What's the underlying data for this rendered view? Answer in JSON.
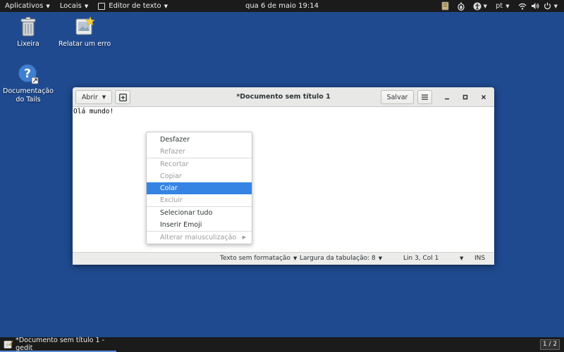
{
  "topbar": {
    "applications": "Aplicativos",
    "places": "Locais",
    "text_editor": "Editor de texto",
    "clock": "qua 6 de maio  19:14",
    "language": "pt",
    "tray_icons": [
      "keyring-icon",
      "tor-onion-icon",
      "accessibility-icon",
      "network-wifi-icon",
      "volume-icon",
      "power-icon"
    ]
  },
  "desktop": {
    "icons": [
      {
        "label": "Lixeira",
        "icon": "trash-icon"
      },
      {
        "label": "Relatar um erro",
        "icon": "report-bug-icon"
      },
      {
        "label": "Documentação do Tails",
        "icon": "help-documentation-icon"
      }
    ]
  },
  "window": {
    "title": "*Documento sem título 1",
    "open_label": "Abrir",
    "save_label": "Salvar",
    "content": "Olá mundo!",
    "statusbar": {
      "format": "Texto sem formatação",
      "tab_width": "Largura da tabulação: 8",
      "position": "Lin 3, Col 1",
      "mode": "INS"
    }
  },
  "context_menu": {
    "items": [
      {
        "label": "Desfazer",
        "enabled": true
      },
      {
        "label": "Refazer",
        "enabled": false
      },
      {
        "label": "Recortar",
        "enabled": false
      },
      {
        "label": "Copiar",
        "enabled": false
      },
      {
        "label": "Colar",
        "enabled": true,
        "selected": true
      },
      {
        "label": "Excluir",
        "enabled": false
      },
      {
        "label": "Selecionar tudo",
        "enabled": true
      },
      {
        "label": "Inserir Emoji",
        "enabled": true
      },
      {
        "label": "Alterar maiusculização",
        "enabled": false
      }
    ]
  },
  "taskbar": {
    "task_title": "*Documento sem título 1 - gedit",
    "workspace": "1 / 2"
  },
  "colors": {
    "desktop_bg": "#1f4a8f",
    "topbar_bg": "#1b1b1b",
    "selection": "#3584e4"
  }
}
